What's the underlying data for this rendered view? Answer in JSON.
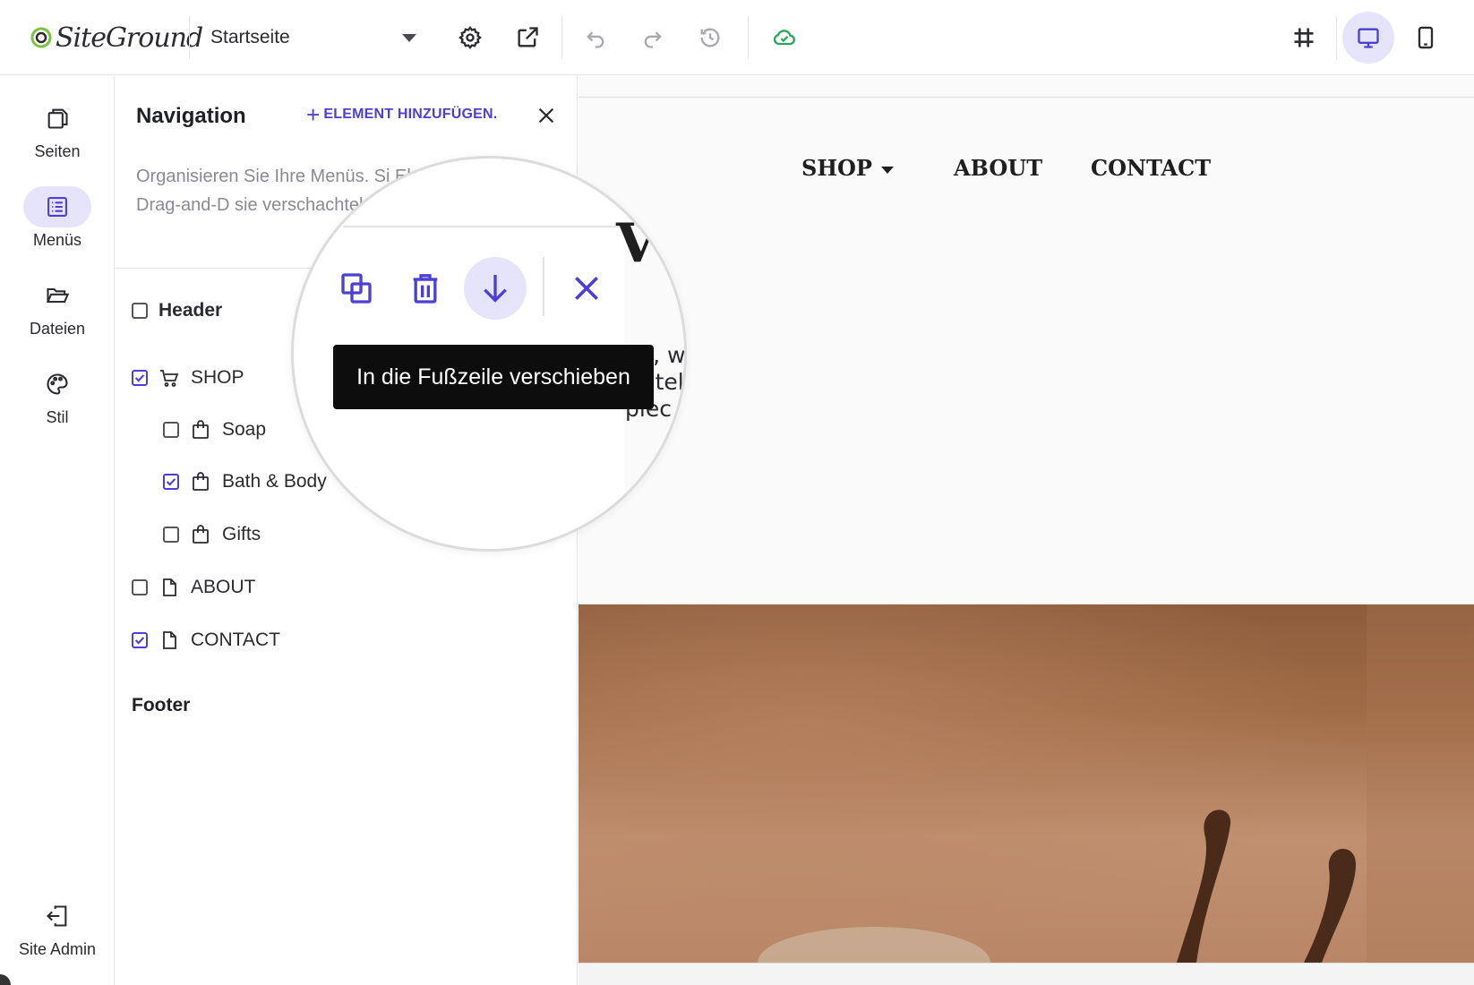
{
  "topbar": {
    "brand": "SiteGround",
    "page_selector": "Startseite",
    "icons": [
      "settings-icon",
      "open-external-icon",
      "undo-icon",
      "redo-icon",
      "history-icon",
      "cloud-saved-icon",
      "grid-icon",
      "desktop-view-icon",
      "mobile-view-icon"
    ],
    "active_view": "desktop"
  },
  "rail": {
    "items": [
      {
        "label": "Seiten",
        "icon": "pages-icon"
      },
      {
        "label": "Menüs",
        "icon": "menus-icon",
        "active": true
      },
      {
        "label": "Dateien",
        "icon": "files-icon"
      },
      {
        "label": "Stil",
        "icon": "palette-icon"
      }
    ],
    "admin_label": "Site Admin"
  },
  "panel": {
    "title": "Navigation",
    "add_label": "ELEMENT HINZUFÜGEN.",
    "description": "Organisieren Sie Ihre Menüs. Si Elemente per Drag-and-D sie verschachteln.",
    "header_label": "Header",
    "items": [
      {
        "label": "SHOP",
        "icon": "cart-icon",
        "checked": true,
        "level": 0
      },
      {
        "label": "Soap",
        "icon": "bag-icon",
        "checked": false,
        "level": 1
      },
      {
        "label": "Bath & Body",
        "icon": "bag-icon",
        "checked": true,
        "level": 1
      },
      {
        "label": "Gifts",
        "icon": "bag-icon",
        "checked": false,
        "level": 1
      },
      {
        "label": "ABOUT",
        "icon": "page-icon",
        "checked": false,
        "level": 0
      },
      {
        "label": "CONTACT",
        "icon": "page-icon",
        "checked": true,
        "level": 0
      }
    ],
    "footer_label": "Footer"
  },
  "preview": {
    "nav": [
      "SHOP",
      "ABOUT",
      "CONTACT"
    ],
    "text_lines": [
      "on, weve in",
      "ut tell a",
      "piec"
    ],
    "glyph": "V"
  },
  "magnifier": {
    "actions": [
      "duplicate-icon",
      "delete-icon",
      "move-down-icon",
      "close-icon"
    ],
    "tooltip": "In die Fußzeile verschieben"
  },
  "colors": {
    "accent": "#4d3fd4",
    "accent_light": "#e6e4fb",
    "cloud_green": "#2aa65a",
    "tooltip_bg": "#0d0d0d"
  }
}
